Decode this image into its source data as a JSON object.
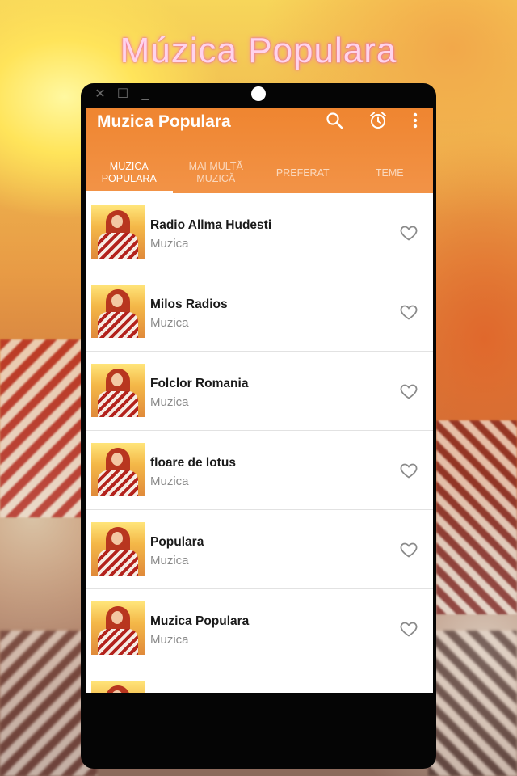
{
  "promo_title": "Múzica Populara",
  "app": {
    "title": "Muzica Populara",
    "icons": [
      "search-icon",
      "alarm-clock-icon",
      "more-vert-icon"
    ],
    "accent_color": "#f08b3a"
  },
  "tabs": [
    {
      "label": "MUZICA\nPOPULARA",
      "active": true
    },
    {
      "label": "MAI MULTĂ\nMUZICĂ",
      "active": false
    },
    {
      "label": "PREFERAT",
      "active": false
    },
    {
      "label": "TEME",
      "active": false
    }
  ],
  "stations": [
    {
      "title": "Radio Allma Hudesti",
      "subtitle": "Muzica"
    },
    {
      "title": "Milos Radios",
      "subtitle": "Muzica"
    },
    {
      "title": "Folclor Romania",
      "subtitle": "Muzica"
    },
    {
      "title": "floare de lotus",
      "subtitle": "Muzica"
    },
    {
      "title": "Populara",
      "subtitle": "Muzica"
    },
    {
      "title": "Muzica Populara",
      "subtitle": "Muzica"
    }
  ]
}
